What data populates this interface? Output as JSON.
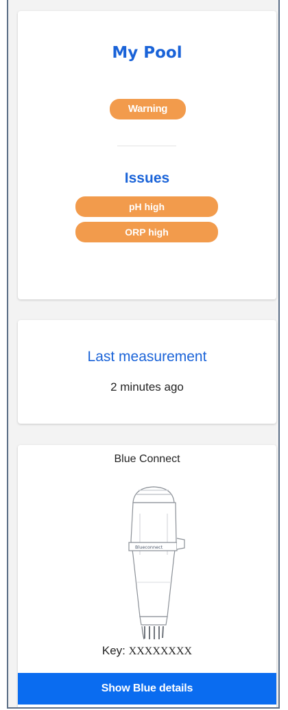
{
  "pool": {
    "title": "My Pool",
    "status": "Warning",
    "issues_title": "Issues",
    "issues": [
      "pH high",
      "ORP high"
    ]
  },
  "measurement": {
    "title": "Last measurement",
    "time": "2 minutes ago"
  },
  "device": {
    "title": "Blue Connect",
    "device_label": "Blueconnect",
    "key_label": "Key:",
    "key_value": "XXXXXXXX",
    "button_label": "Show Blue details"
  },
  "colors": {
    "accent": "#1a63d8",
    "badge": "#f29b4c",
    "button": "#0a6cf0"
  }
}
